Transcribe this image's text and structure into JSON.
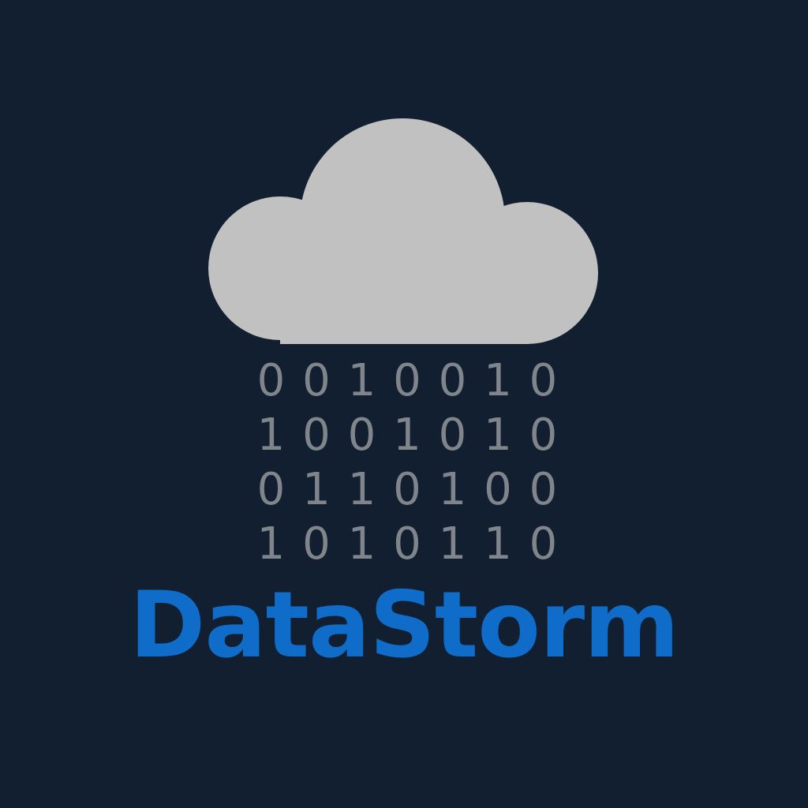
{
  "logo": {
    "icon": "cloud-icon",
    "binary_rows": [
      [
        "0",
        "0",
        "1",
        "0",
        "0",
        "1",
        "0"
      ],
      [
        "1",
        "0",
        "0",
        "1",
        "0",
        "1",
        "0"
      ],
      [
        "0",
        "1",
        "1",
        "0",
        "1",
        "0",
        "0"
      ],
      [
        "1",
        "0",
        "1",
        "0",
        "1",
        "1",
        "0"
      ]
    ],
    "name": "DataStorm"
  },
  "colors": {
    "background": "#111f30",
    "cloud": "#c1c1c1",
    "binary_digits": "#80858b",
    "brand": "#0f6dc9"
  }
}
